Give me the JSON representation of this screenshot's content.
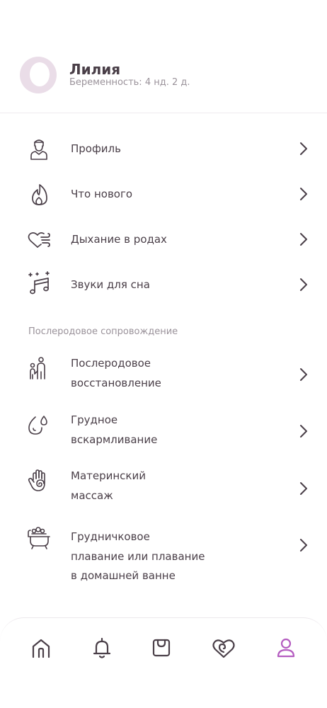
{
  "profile": {
    "name": "Лилия",
    "status": "Беременность: 4 нд. 2 д."
  },
  "menu": {
    "items": [
      {
        "label": "Профиль",
        "icon": "profile-person-icon"
      },
      {
        "label": "Что нового",
        "icon": "flame-icon"
      },
      {
        "label": "Дыхание в родах",
        "icon": "heart-breath-icon"
      },
      {
        "label": "Звуки для сна",
        "icon": "music-note-icon"
      }
    ]
  },
  "postpartum": {
    "section_title": "Послеродовое сопровождение",
    "items": [
      {
        "line1": "Послеродовое",
        "line2": "восстановление",
        "icon": "mother-child-icon"
      },
      {
        "line1": "Грудное",
        "line2": "вскармливание",
        "icon": "milk-drops-icon"
      },
      {
        "line1": "Материнский",
        "line2": "массаж",
        "icon": "hand-spiral-icon"
      },
      {
        "line1": "Грудничковое",
        "line2": "плавание или плавание",
        "line3": "в домашней ванне",
        "icon": "bathtub-icon"
      }
    ]
  },
  "tabbar": {
    "tabs": [
      {
        "name": "home",
        "icon": "home-icon",
        "active": false
      },
      {
        "name": "notifications",
        "icon": "bell-icon",
        "active": false
      },
      {
        "name": "shop",
        "icon": "bag-icon",
        "active": false
      },
      {
        "name": "care",
        "icon": "heart-swirl-icon",
        "active": false
      },
      {
        "name": "profile",
        "icon": "user-icon",
        "active": true
      }
    ],
    "active_color": "#b45cc0",
    "inactive_color": "#4a3f48"
  }
}
